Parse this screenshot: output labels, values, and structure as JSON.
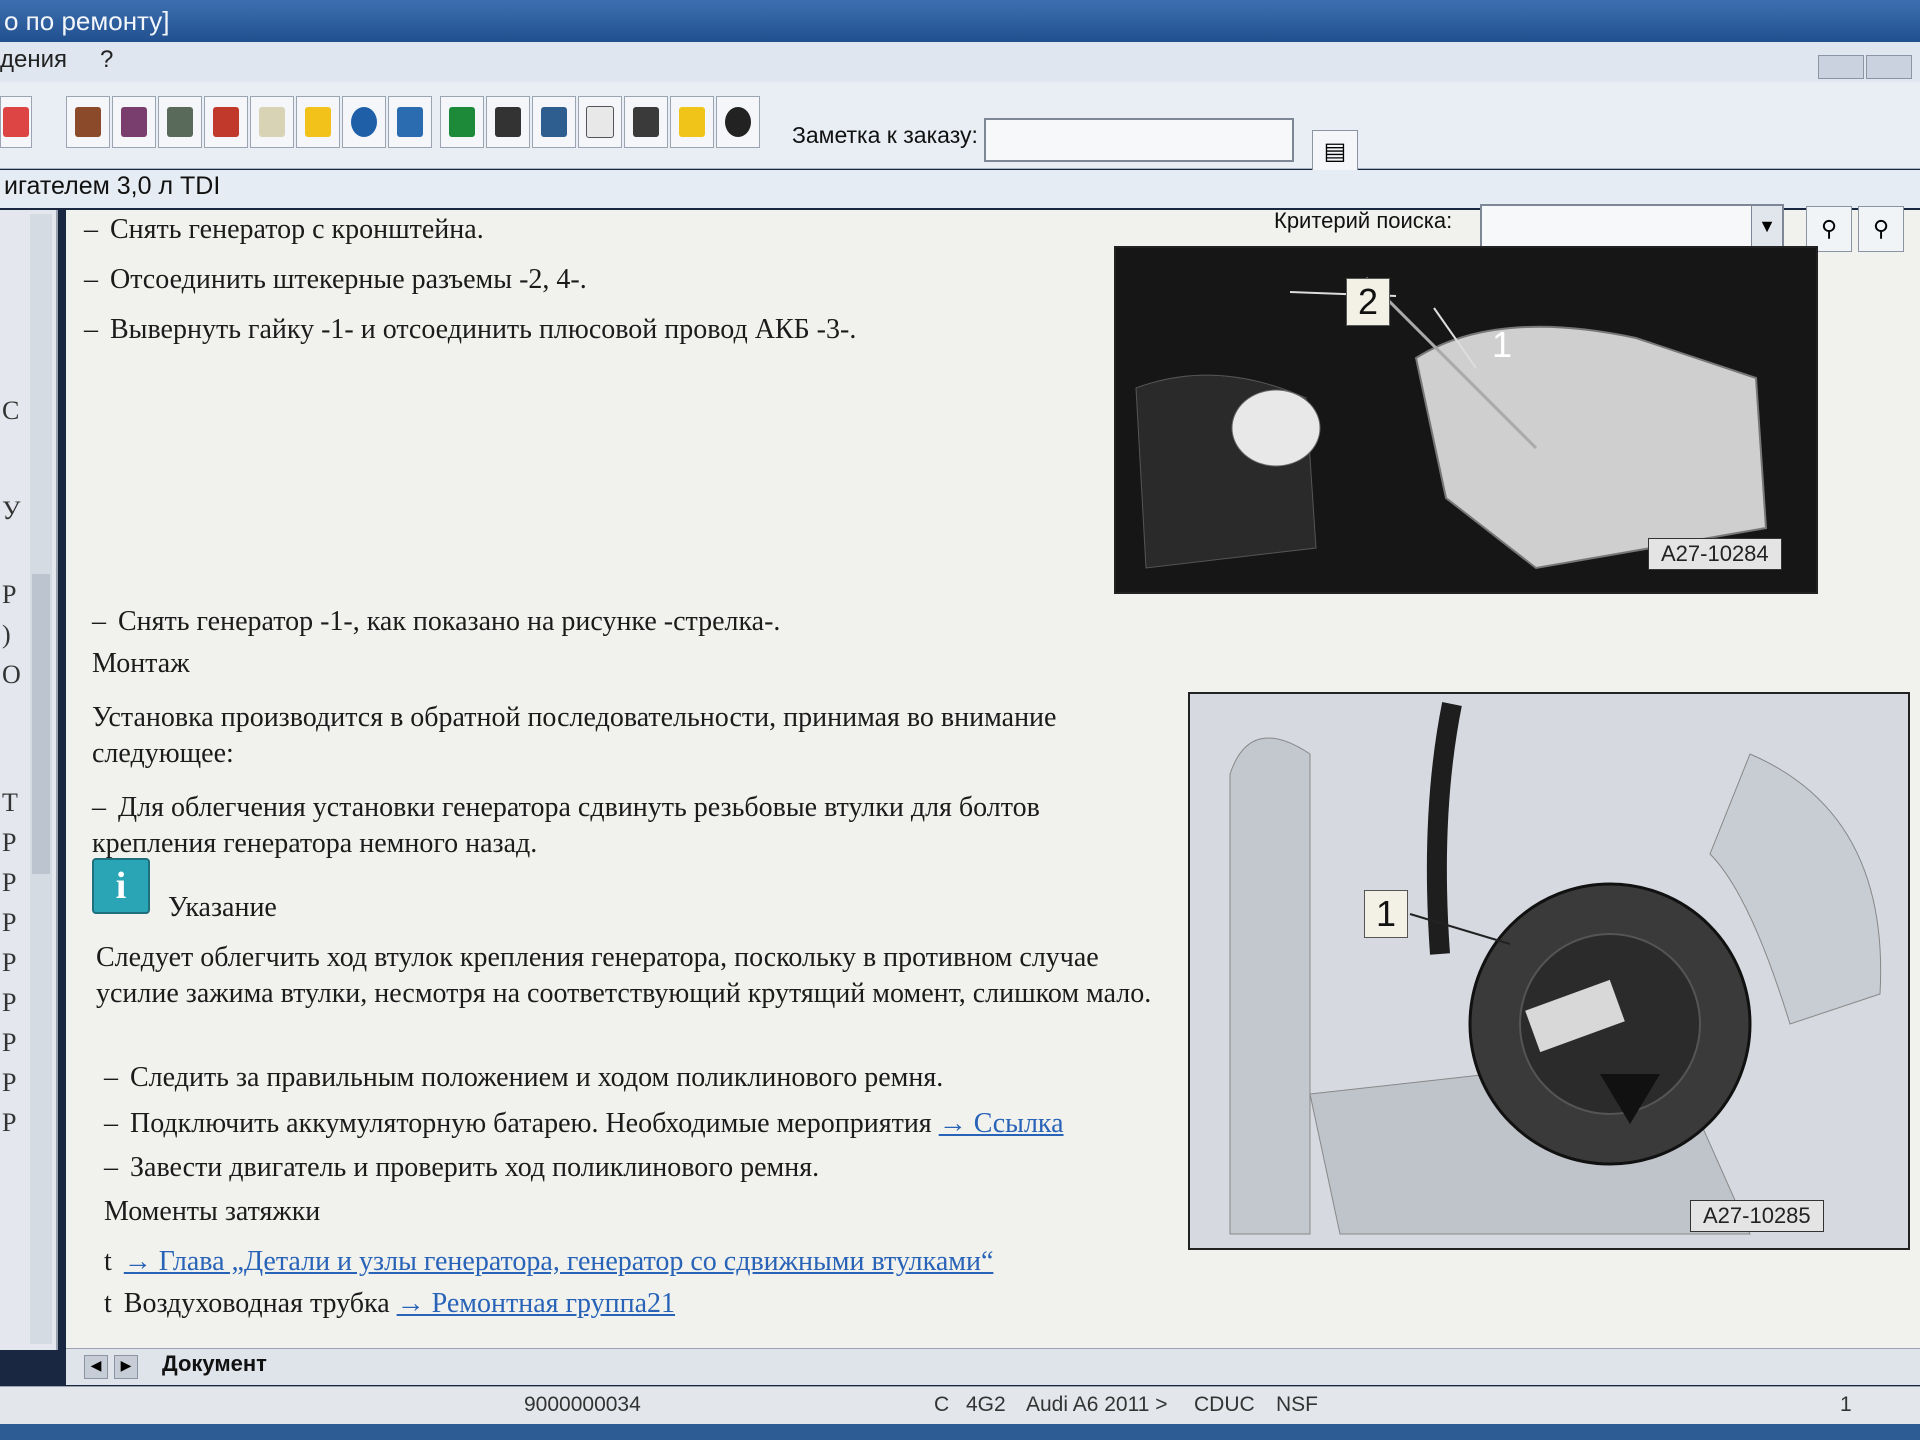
{
  "window": {
    "title": "о по ремонту]"
  },
  "menu": {
    "items": [
      "дения",
      "?"
    ]
  },
  "toolbar": {
    "icons": [
      "catalog-icon",
      "grid-icon",
      "figure-icon",
      "book-icon",
      "list-icon",
      "warning-icon",
      "globe-icon",
      "save-icon",
      "pen-icon",
      "car-icon",
      "truck-icon",
      "check-icon",
      "edit-icon",
      "help-icon",
      "stack-icon"
    ],
    "note_label": "Заметка к заказу:",
    "note_value": ""
  },
  "subtitle": "игателем 3,0 л TDI",
  "search": {
    "label": "Критерий поиска:",
    "value": ""
  },
  "left_panel": {
    "chars": [
      "С",
      "У",
      "Р",
      ")",
      "О",
      "Т",
      "Р",
      "Р",
      "Р",
      "Р",
      "Р",
      "Р",
      "Р",
      "Р"
    ]
  },
  "content": {
    "line1": "Снять генератор с кронштейна.",
    "line2": "Отсоединить штекерные разъемы -2, 4-.",
    "line3": "Вывернуть гайку -1- и отсоединить плюсовой провод АКБ -3-.",
    "line4": "Снять генератор -1-, как показано на рисунке -стрелка-.",
    "heading_install": "Монтаж",
    "install_intro": "Установка производится в обратной последовательности, принимая во внимание следующее:",
    "bullet_sleeves": "Для облегчения установки генератора сдвинуть резьбовые втулки для болтов крепления генератора немного назад.",
    "note_title": "Указание",
    "note_text": "Следует облегчить ход втулок крепления генератора, поскольку в противном случае усилие зажима втулки, несмотря на соответствующий крутящий момент, слишком мало.",
    "bullet_belt": "Следить за правильным положением и ходом поликлинового ремня.",
    "bullet_battery": "Подключить аккумуляторную батарею. Необходимые мероприятия",
    "battery_link": "→ Ссылка",
    "bullet_engine": "Завести двигатель и проверить ход поликлинового ремня.",
    "torque_heading": "Моменты затяжки",
    "torque_link1": "→ Глава „Детали и узлы генератора, генератор со сдвижными втулками“",
    "torque_item2": "Воздуховодная трубка",
    "torque_link2": "→ Ремонтная группа21"
  },
  "figure1": {
    "code": "A27-10284",
    "callouts": [
      "2",
      "1"
    ]
  },
  "figure2": {
    "code": "A27-10285",
    "callouts": [
      "1"
    ]
  },
  "tabs": {
    "document": "Документ"
  },
  "status": {
    "order": "9000000034",
    "c": "C",
    "model_code": "4G2",
    "vehicle": "Audi A6 2011 >",
    "engine": "CDUC",
    "nsf": "NSF",
    "page": "1"
  },
  "colors": {
    "link": "#2863b7",
    "info_icon": "#2aa5b5",
    "titlebar": "#2f5f9f"
  }
}
